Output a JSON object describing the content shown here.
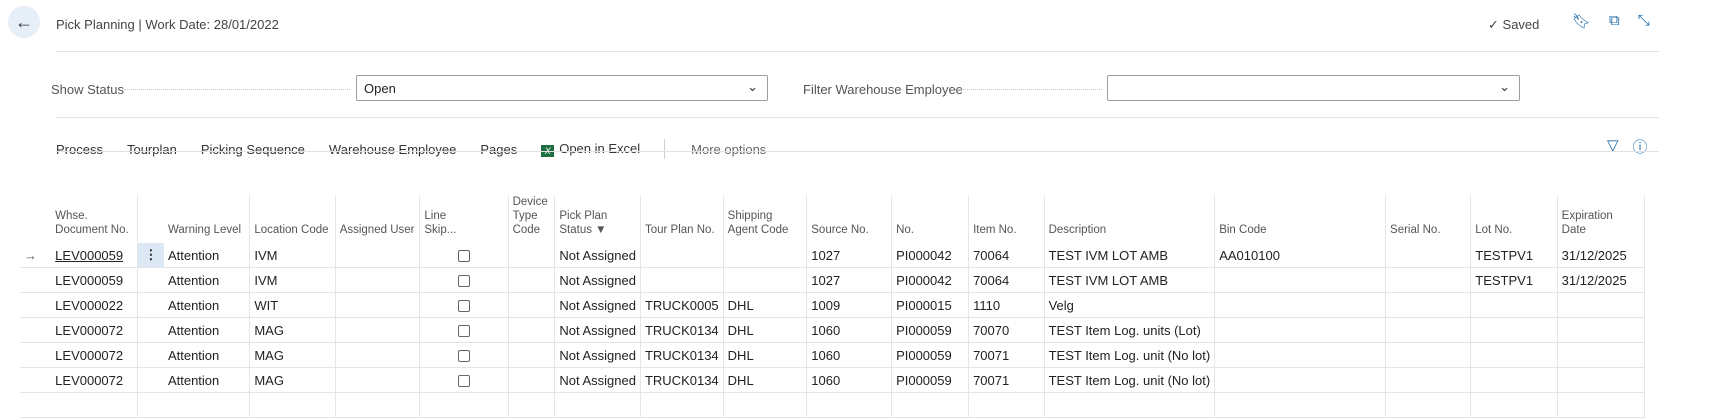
{
  "header": {
    "title": "Pick Planning | Work Date: 28/01/2022",
    "saved": "Saved"
  },
  "filters": {
    "show_status_label": "Show Status",
    "show_status_value": "Open",
    "warehouse_employee_label": "Filter Warehouse Employee",
    "warehouse_employee_value": ""
  },
  "actions": {
    "process": "Process",
    "tourplan": "Tourplan",
    "picking_sequence": "Picking Sequence",
    "warehouse_employee": "Warehouse Employee",
    "pages": "Pages",
    "open_in_excel": "Open in Excel",
    "more_options": "More options"
  },
  "table": {
    "columns": {
      "doc_no_1": "Whse.",
      "doc_no_2": "Document No.",
      "warning_level": "Warning Level",
      "location_code": "Location Code",
      "assigned_user": "Assigned User",
      "line_skip_1": "Line",
      "line_skip_2": "Skip...",
      "device_type_1": "Device Type",
      "device_type_2": "Code",
      "pick_plan_1": "Pick Plan",
      "pick_plan_2": "Status",
      "tour_plan_no": "Tour Plan No.",
      "shipping_agent_1": "Shipping",
      "shipping_agent_2": "Agent Code",
      "source_no": "Source No.",
      "no": "No.",
      "item_no": "Item No.",
      "description": "Description",
      "bin_code": "Bin Code",
      "serial_no": "Serial No.",
      "lot_no": "Lot No.",
      "expiration_1": "Expiration",
      "expiration_2": "Date"
    },
    "rows": [
      {
        "doc": "LEV000059",
        "warning": "Attention",
        "location": "IVM",
        "user": "",
        "device": "",
        "status": "Not Assigned",
        "tour": "",
        "agent": "",
        "source": "1027",
        "no": "PI000042",
        "item": "70064",
        "desc": "TEST IVM LOT AMB",
        "bin": "AA010100",
        "serial": "",
        "lot": "TESTPV1",
        "exp": "31/12/2025"
      },
      {
        "doc": "LEV000059",
        "warning": "Attention",
        "location": "IVM",
        "user": "",
        "device": "",
        "status": "Not Assigned",
        "tour": "",
        "agent": "",
        "source": "1027",
        "no": "PI000042",
        "item": "70064",
        "desc": "TEST IVM LOT AMB",
        "bin": "",
        "serial": "",
        "lot": "TESTPV1",
        "exp": "31/12/2025"
      },
      {
        "doc": "LEV000022",
        "warning": "Attention",
        "location": "WIT",
        "user": "",
        "device": "",
        "status": "Not Assigned",
        "tour": "TRUCK0005",
        "agent": "DHL",
        "source": "1009",
        "no": "PI000015",
        "item": "1110",
        "desc": "Velg",
        "bin": "",
        "serial": "",
        "lot": "",
        "exp": ""
      },
      {
        "doc": "LEV000072",
        "warning": "Attention",
        "location": "MAG",
        "user": "",
        "device": "",
        "status": "Not Assigned",
        "tour": "TRUCK0134",
        "agent": "DHL",
        "source": "1060",
        "no": "PI000059",
        "item": "70070",
        "desc": "TEST Item Log. units (Lot)",
        "bin": "",
        "serial": "",
        "lot": "",
        "exp": ""
      },
      {
        "doc": "LEV000072",
        "warning": "Attention",
        "location": "MAG",
        "user": "",
        "device": "",
        "status": "Not Assigned",
        "tour": "TRUCK0134",
        "agent": "DHL",
        "source": "1060",
        "no": "PI000059",
        "item": "70071",
        "desc": "TEST Item Log. unit (No lot)",
        "bin": "",
        "serial": "",
        "lot": "",
        "exp": ""
      },
      {
        "doc": "LEV000072",
        "warning": "Attention",
        "location": "MAG",
        "user": "",
        "device": "",
        "status": "Not Assigned",
        "tour": "TRUCK0134",
        "agent": "DHL",
        "source": "1060",
        "no": "PI000059",
        "item": "70071",
        "desc": "TEST Item Log. unit (No lot)",
        "bin": "",
        "serial": "",
        "lot": "",
        "exp": ""
      }
    ]
  },
  "colors": {
    "accent": "#1f6aa5",
    "link_olive": "#6b6b00"
  }
}
